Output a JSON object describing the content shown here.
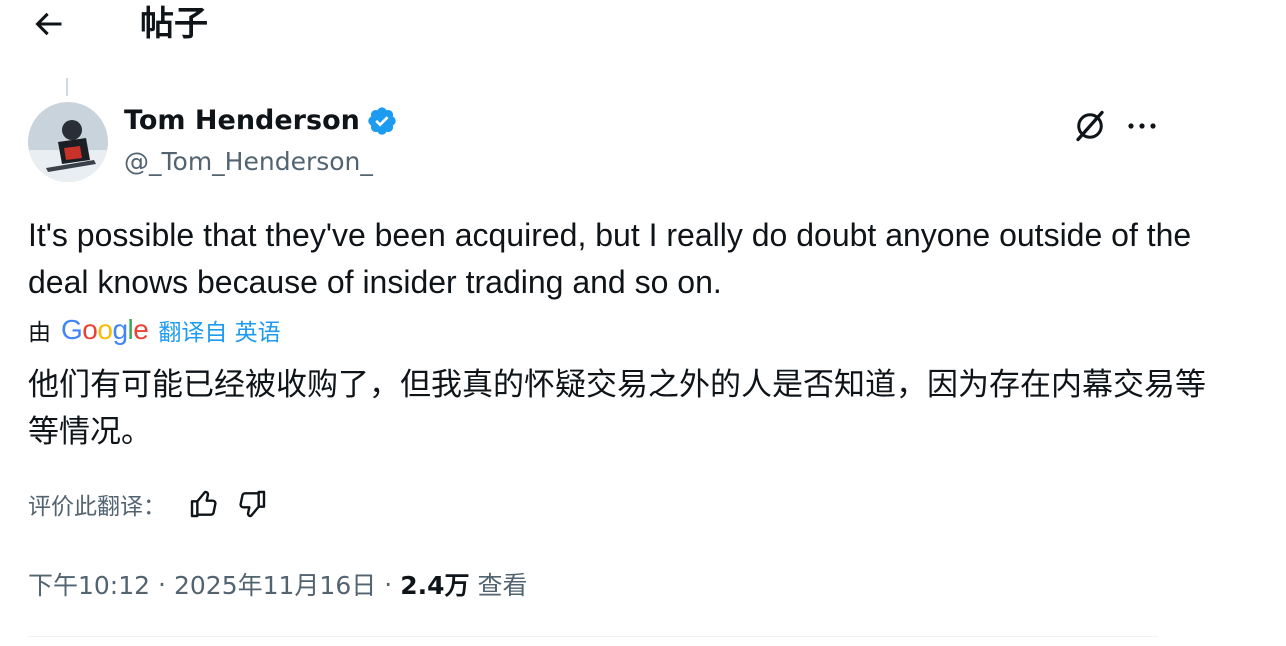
{
  "header": {
    "back_icon": "arrow-left-icon",
    "title": "帖子"
  },
  "author": {
    "name": "Tom Henderson",
    "handle": "@_Tom_Henderson_",
    "verified_icon": "verified-badge-icon",
    "verified_color": "#1d9bf0"
  },
  "actions": {
    "grok_icon": "grok-icon",
    "more_icon": "more-horizontal-icon"
  },
  "tweet": {
    "text": "It's possible that they've been acquired, but I really do doubt anyone outside of the deal knows because of insider trading and so on."
  },
  "translation": {
    "by_label": "由",
    "provider": "Google",
    "from_label": "翻译自 英语",
    "text": "他们有可能已经被收购了，但我真的怀疑交易之外的人是否知道，因为存在内幕交易等等情况。",
    "rate_label": "评价此翻译：",
    "thumbs_up_icon": "thumbs-up-icon",
    "thumbs_down_icon": "thumbs-down-icon"
  },
  "meta": {
    "time": "下午10:12",
    "separator": "·",
    "date": "2025年11月16日",
    "views_count": "2.4万",
    "views_label": "查看"
  },
  "colors": {
    "accent": "#1d9bf0",
    "secondary_text": "#536471",
    "text": "#0f1419"
  }
}
